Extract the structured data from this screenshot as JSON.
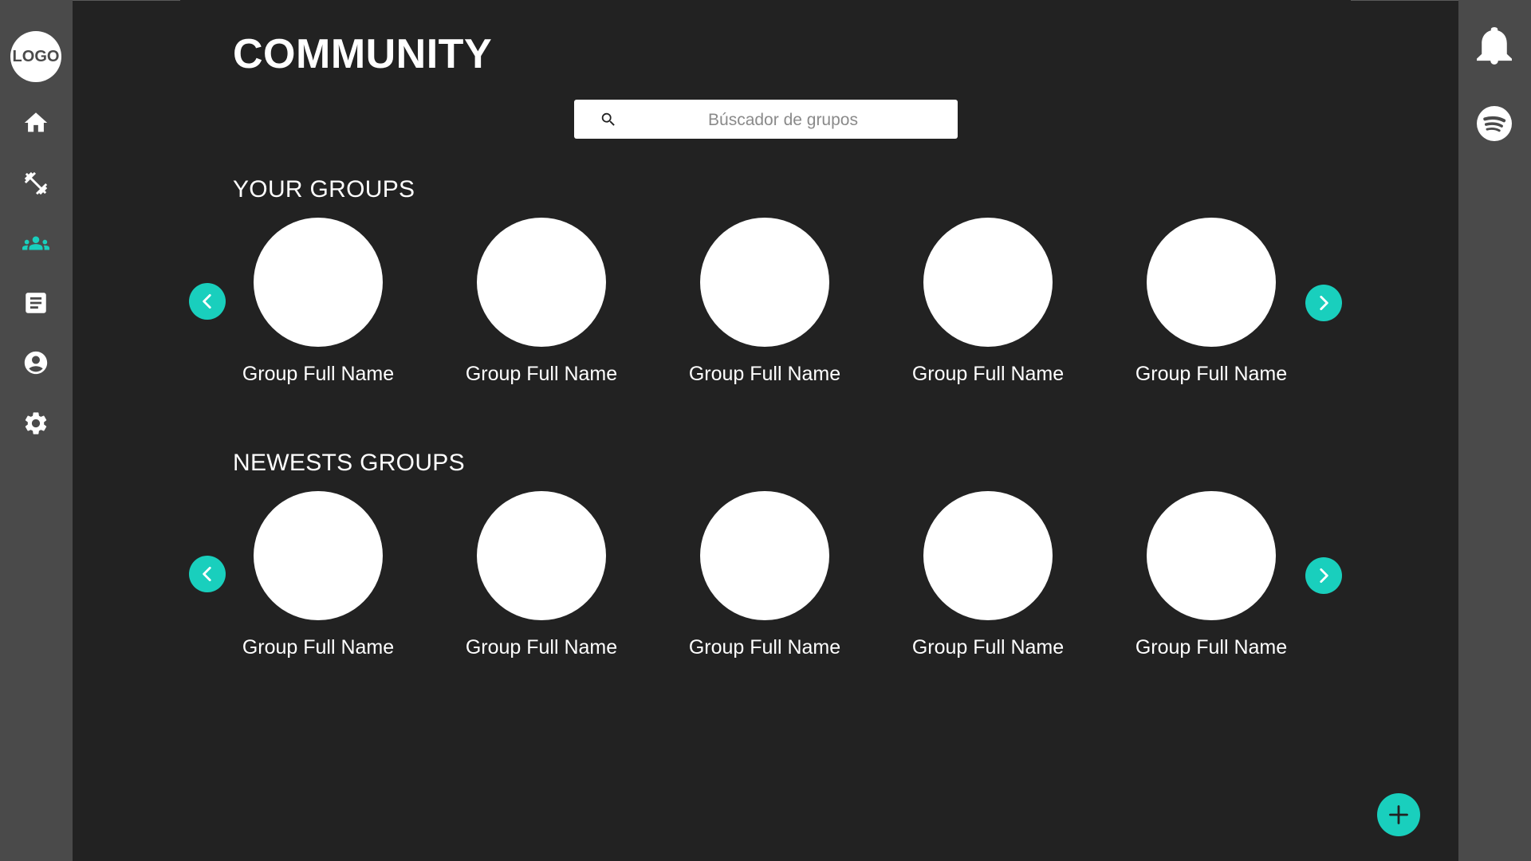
{
  "app": {
    "logo_text": "LOGO",
    "accent_color": "#19cfbd",
    "active_nav": "community"
  },
  "sidebar": {
    "items": [
      {
        "id": "home",
        "icon": "home-icon"
      },
      {
        "id": "workouts",
        "icon": "dumbbell-icon"
      },
      {
        "id": "community",
        "icon": "group-icon"
      },
      {
        "id": "notes",
        "icon": "document-icon"
      },
      {
        "id": "profile",
        "icon": "account-circle-icon"
      },
      {
        "id": "settings",
        "icon": "gear-icon"
      }
    ]
  },
  "header": {
    "title": "COMMUNITY"
  },
  "search": {
    "placeholder": "Búscador de grupos",
    "value": ""
  },
  "your_groups": {
    "title": "YOUR GROUPS",
    "groups": [
      {
        "name": "Group Full Name"
      },
      {
        "name": "Group Full Name"
      },
      {
        "name": "Group Full Name"
      },
      {
        "name": "Group Full Name"
      },
      {
        "name": "Group Full Name"
      }
    ]
  },
  "newest_groups": {
    "title": "NEWESTS GROUPS",
    "groups": [
      {
        "name": "Group Full Name"
      },
      {
        "name": "Group Full Name"
      },
      {
        "name": "Group Full Name"
      },
      {
        "name": "Group Full Name"
      },
      {
        "name": "Group Full Name"
      }
    ]
  },
  "right_bar": {
    "icons": [
      "bell-icon",
      "spotify-icon"
    ]
  },
  "fab": {
    "icon": "plus-icon"
  }
}
